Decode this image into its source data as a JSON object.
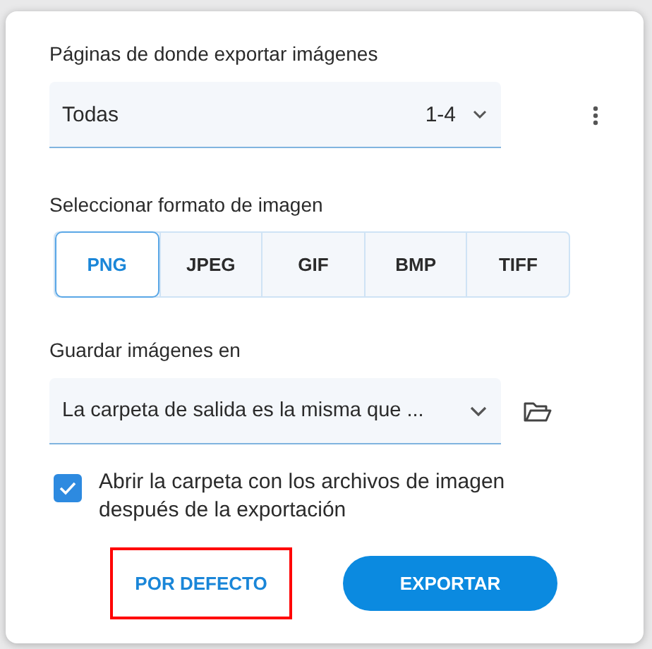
{
  "pages": {
    "label": "Páginas de donde exportar imágenes",
    "value": "Todas",
    "range": "1-4"
  },
  "format": {
    "label": "Seleccionar formato de imagen",
    "options": [
      {
        "label": "PNG",
        "selected": true
      },
      {
        "label": "JPEG",
        "selected": false
      },
      {
        "label": "GIF",
        "selected": false
      },
      {
        "label": "BMP",
        "selected": false
      },
      {
        "label": "TIFF",
        "selected": false
      }
    ]
  },
  "save": {
    "label": "Guardar imágenes en",
    "value": "La carpeta de salida es la misma que ..."
  },
  "open_folder": {
    "label": "Abrir la carpeta con los archivos de imagen después de la exportación",
    "checked": true
  },
  "buttons": [
    {
      "label": "POR DEFECTO",
      "kind": "text",
      "highlighted": true
    },
    {
      "label": "EXPORTAR",
      "kind": "primary",
      "highlighted": false
    }
  ]
}
